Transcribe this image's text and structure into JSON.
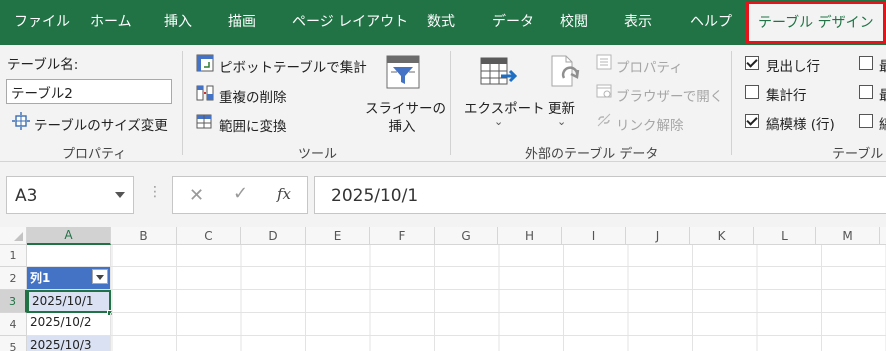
{
  "tabs": [
    {
      "label": "ファイル"
    },
    {
      "label": "ホーム"
    },
    {
      "label": "挿入"
    },
    {
      "label": "描画"
    },
    {
      "label": "ページ レイアウト"
    },
    {
      "label": "数式"
    },
    {
      "label": "データ"
    },
    {
      "label": "校閲"
    },
    {
      "label": "表示"
    },
    {
      "label": "ヘルプ"
    },
    {
      "label": "テーブル デザイン",
      "active": true
    }
  ],
  "ribbon": {
    "properties": {
      "name_label": "テーブル名:",
      "name_value": "テーブル2",
      "resize_label": "テーブルのサイズ変更",
      "group_label": "プロパティ"
    },
    "tools": {
      "pivot_label": "ピボットテーブルで集計",
      "remove_dup_label": "重複の削除",
      "convert_range_label": "範囲に変換",
      "slicer_label_1": "スライサーの",
      "slicer_label_2": "挿入",
      "group_label": "ツール"
    },
    "external": {
      "export_label": "エクスポート",
      "refresh_label": "更新",
      "properties_label": "プロパティ",
      "open_browser_label": "ブラウザーで開く",
      "unlink_label": "リンク解除",
      "group_label": "外部のテーブル データ"
    },
    "style_options": {
      "header_row": {
        "label": "見出し行",
        "checked": true
      },
      "total_row": {
        "label": "集計行",
        "checked": false
      },
      "banded_rows": {
        "label": "縞模様 (行)",
        "checked": true
      },
      "truncated_col2_1": "最",
      "truncated_col2_2": "最",
      "truncated_col2_3": "縞",
      "group_label": "テーブル"
    }
  },
  "formula_bar": {
    "cell_name": "A3",
    "formula": "2025/10/1",
    "cancel_symbol": "✕",
    "enter_symbol": "✓",
    "fx_symbol": "fx"
  },
  "grid": {
    "columns": [
      "A",
      "B",
      "C",
      "D",
      "E",
      "F",
      "G",
      "H",
      "I",
      "J",
      "K",
      "L",
      "M"
    ],
    "rows": [
      "1",
      "2",
      "3",
      "4",
      "5"
    ],
    "table_header": "列1",
    "cells": {
      "A3": "2025/10/1",
      "A4": "2025/10/2",
      "A5": "2025/10/3"
    },
    "selected_cell": "A3",
    "colors": {
      "table_header_bg": "#4472c4",
      "band_bg": "#d9e1f2",
      "accent": "#217346"
    }
  }
}
